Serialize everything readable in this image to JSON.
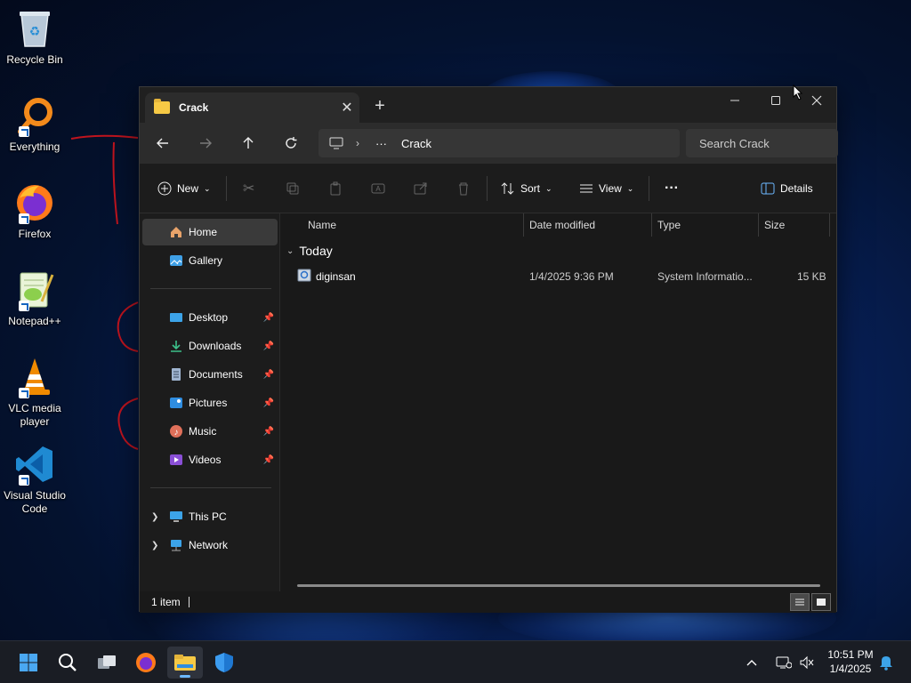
{
  "desktop": {
    "icons": [
      {
        "label": "Recycle Bin",
        "icon": "recycle-bin-icon"
      },
      {
        "label": "Everything",
        "icon": "everything-search-icon"
      },
      {
        "label": "Firefox",
        "icon": "firefox-icon"
      },
      {
        "label": "Notepad++",
        "icon": "notepad-plus-plus-icon"
      },
      {
        "label": "VLC media player",
        "icon": "vlc-cone-icon"
      },
      {
        "label": "Visual Studio Code",
        "icon": "vscode-icon"
      }
    ]
  },
  "window": {
    "tab_title": "Crack",
    "new_tab_label": "+",
    "address": {
      "more": "···",
      "current": "Crack"
    },
    "search_placeholder": "Search Crack",
    "commands": {
      "new_label": "New",
      "sort_label": "Sort",
      "view_label": "View",
      "more_label": "···",
      "details_label": "Details"
    },
    "nav": {
      "home": "Home",
      "gallery": "Gallery",
      "desktop": "Desktop",
      "downloads": "Downloads",
      "documents": "Documents",
      "pictures": "Pictures",
      "music": "Music",
      "videos": "Videos",
      "this_pc": "This PC",
      "network": "Network"
    },
    "columns": {
      "name": "Name",
      "date": "Date modified",
      "type": "Type",
      "size": "Size"
    },
    "group": "Today",
    "files": [
      {
        "name": "diginsan",
        "date": "1/4/2025 9:36 PM",
        "type": "System Informatio...",
        "size": "15 KB"
      }
    ],
    "status": "1 item"
  },
  "taskbar": {
    "clock_time": "10:51 PM",
    "clock_date": "1/4/2025"
  },
  "colors": {
    "accent": "#60b0ff",
    "window_bg": "#191919",
    "scribble": "#c0141e"
  }
}
